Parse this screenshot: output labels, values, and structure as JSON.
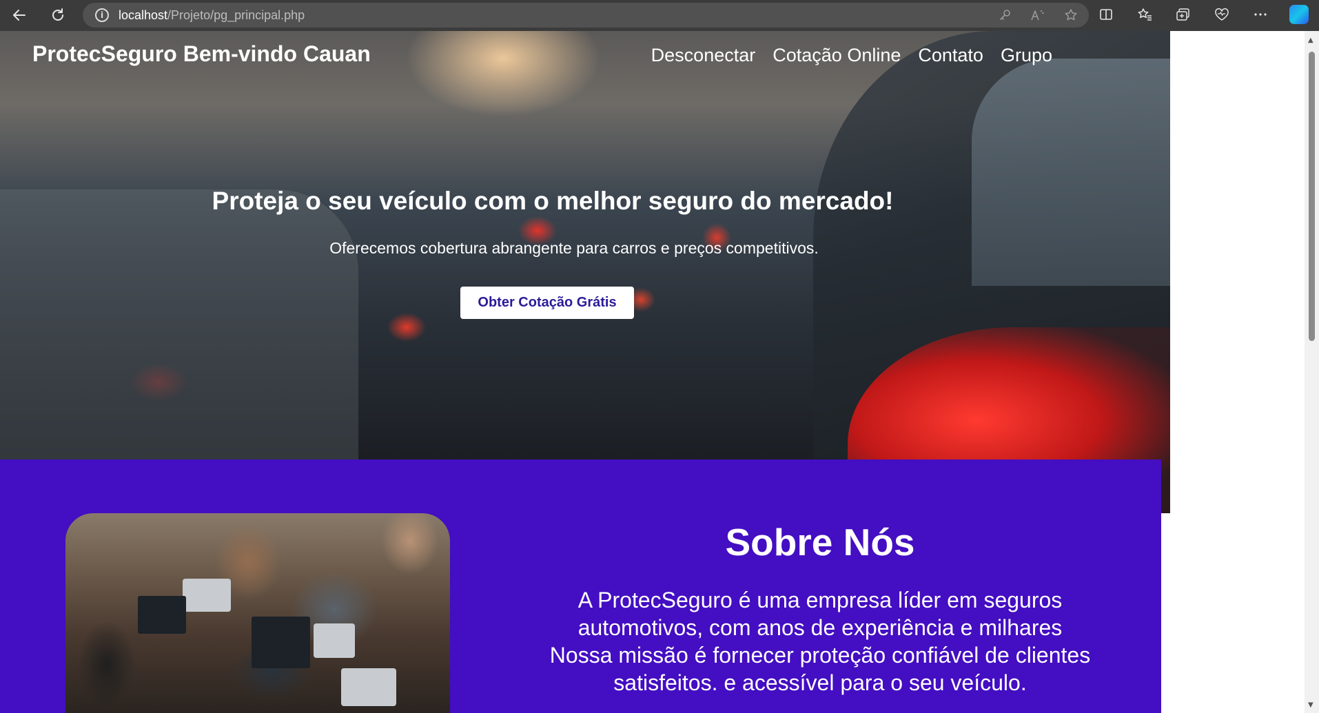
{
  "browser": {
    "url_host": "localhost",
    "url_path": "/Projeto/pg_principal.php",
    "icons": {
      "back": "back-arrow-icon",
      "reload": "reload-icon",
      "info": "info-icon",
      "key": "key-icon",
      "read_aloud": "read-aloud-icon",
      "favorite": "star-icon",
      "split": "split-screen-icon",
      "favorites": "favorites-icon",
      "collections": "collections-icon",
      "health": "browser-essentials-icon",
      "more": "more-icon",
      "copilot": "copilot-icon"
    }
  },
  "header": {
    "brand": "ProtecSeguro Bem-vindo Cauan",
    "nav": [
      "Desconectar",
      "Cotação Online",
      "Contato",
      "Grupo"
    ]
  },
  "hero": {
    "title": "Proteja o seu veículo com o melhor seguro do mercado!",
    "subtitle": "Oferecemos cobertura abrangente para carros e preços competitivos.",
    "cta_label": "Obter Cotação Grátis"
  },
  "about": {
    "title": "Sobre Nós",
    "text_lines": [
      "A ProtecSeguro é uma empresa líder em seguros",
      "automotivos, com anos de experiência e milhares",
      "Nossa missão é fornecer proteção confiável de clientes",
      "satisfeitos. e acessível para o seu veículo."
    ]
  },
  "colors": {
    "about_bg": "#440ec2",
    "cta_text": "#2b1a99",
    "browser_bar": "#3b3b3b"
  }
}
